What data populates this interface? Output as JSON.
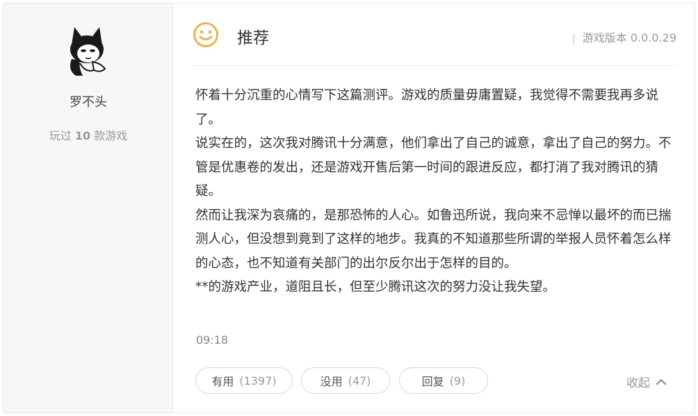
{
  "user": {
    "name": "罗不头",
    "played_prefix": "玩过",
    "played_count": "10",
    "played_suffix": "款游戏"
  },
  "review": {
    "verdict": "推荐",
    "version_label": "游戏版本 0.0.0.29",
    "paragraphs": [
      "怀着十分沉重的心情写下这篇测评。游戏的质量毋庸置疑，我觉得不需要我再多说了。",
      "说实在的，这次我对腾讯十分满意，他们拿出了自己的诚意，拿出了自己的努力。不管是优惠卷的发出，还是游戏开售后第一时间的跟进反应，都打消了我对腾讯的猜疑。",
      "然而让我深为哀痛的，是那恐怖的人心。如鲁迅所说，我向来不忌惮以最坏的而已揣测人心，但没想到竟到了这样的地步。我真的不知道那些所谓的举报人员怀着怎么样的心态，也不知道有关部门的出尔反尔出于怎样的目的。",
      "**的游戏产业，道阻且长，但至少腾讯这次的努力没让我失望。"
    ],
    "time": "09:18"
  },
  "actions": {
    "useful_label": "有用",
    "useful_count": "(1397)",
    "useless_label": "没用",
    "useless_count": "(47)",
    "reply_label": "回复",
    "reply_count": "(9)",
    "collapse_label": "收起"
  },
  "icons": {
    "verdict_icon": "smile-face-icon",
    "collapse_icon": "chevron-up-icon",
    "avatar": "cartoon-cat-avatar"
  },
  "colors": {
    "smile_icon": "#e9b351",
    "text": "#333333",
    "muted": "#999999",
    "panel_bg": "#f7f7f7"
  }
}
